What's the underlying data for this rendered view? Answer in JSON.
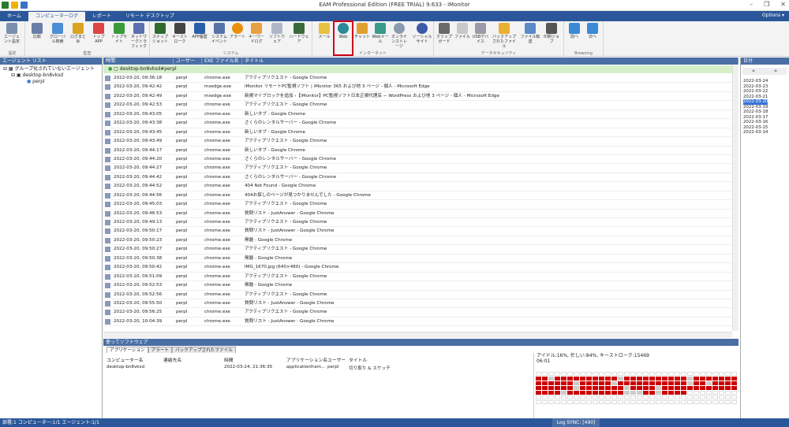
{
  "window": {
    "title": "EAM Professional Edition (FREE TRIAL) 9.633 - iMonitor"
  },
  "tabs": [
    "ホーム",
    "コンピューターログ",
    "レポート",
    "リモート デスクトップ"
  ],
  "options_label": "Options",
  "ribbon": {
    "groups": {
      "settings": "設定",
      "audit": "監査",
      "system": "システム",
      "internet": "インターネット",
      "data_security": "データセキュリティ",
      "browsing": "Browsing"
    },
    "buttons": {
      "agent_settings": "エージェント設定",
      "compare": "比較",
      "global_search": "グローバル検索",
      "log_summary": "ログまとめ",
      "top_app": "トップAPP",
      "top_site": "トップサイト",
      "network_traffic": "ネットワークトラフィック",
      "snapshot": "スナップショット",
      "keystrokes": "キーストローク",
      "app_history": "APP履歴",
      "system_events": "システムイベント",
      "alerts": "アラート",
      "keyword_log": "キーワードログ",
      "software": "ソフトウェア",
      "hardware": "ハードウェア",
      "mail": "メール",
      "web": "Web",
      "chat": "チャット",
      "web_mail": "Webメール",
      "online_storage": "オンラインストレージ",
      "social_site": "ソーシャルサイト",
      "clipboard": "クリップボード",
      "file": "ファイル",
      "usb_device": "USBデバイス",
      "backup_files": "バックアップされたファイル",
      "file_transfer": "ファイル転送",
      "print_job": "印刷ジョブ",
      "prev": "前へ",
      "next": "次へ"
    }
  },
  "agent_list": {
    "title": "エージェント リスト",
    "ungrouped": "グループ化されていないエージェント",
    "computer": "desktop-bn8vksd",
    "user": "perpl"
  },
  "grid": {
    "columns": [
      "時間",
      "ユーザー",
      "EXE ファイル名",
      "タイトル"
    ],
    "group_label": "desktop-bn8vksd#perpl",
    "rows": [
      [
        "2022-03-20, 09:36:18",
        "perpl",
        "chrome.exe",
        "アクティブリクエスト - Google Chrome"
      ],
      [
        "2022-03-20, 09:42:42",
        "perpl",
        "msedge.exe",
        "iMonitor リモートPC監視ソフト | iMonitor 365 および他 3 ページ - 個人 - Microsoft Edge"
      ],
      [
        "2022-03-20, 09:42:49",
        "perpl",
        "msedge.exe",
        "新規マイブロックを追加 ‹【iMonitor】PC監視ソフト日本正規代理店 − WordPress および他 3 ページ - 個人 - Microsoft Edge"
      ],
      [
        "2022-03-20, 09:42:53",
        "perpl",
        "chrome.exe",
        "アクティブリクエスト - Google Chrome"
      ],
      [
        "2022-03-20, 09:43:05",
        "perpl",
        "chrome.exe",
        "新しいタブ - Google Chrome"
      ],
      [
        "2022-03-20, 09:43:38",
        "perpl",
        "chrome.exe",
        "さくらのレンタルサーバー - Google Chrome"
      ],
      [
        "2022-03-20, 09:43:45",
        "perpl",
        "chrome.exe",
        "新しいタブ - Google Chrome"
      ],
      [
        "2022-03-20, 09:43:49",
        "perpl",
        "chrome.exe",
        "アクティブリクエスト - Google Chrome"
      ],
      [
        "2022-03-20, 09:44:17",
        "perpl",
        "chrome.exe",
        "新しいタブ - Google Chrome"
      ],
      [
        "2022-03-20, 09:44:20",
        "perpl",
        "chrome.exe",
        "さくらのレンタルサーバー - Google Chrome"
      ],
      [
        "2022-03-20, 09:44:27",
        "perpl",
        "chrome.exe",
        "アクティブリクエスト - Google Chrome"
      ],
      [
        "2022-03-20, 09:44:42",
        "perpl",
        "chrome.exe",
        "さくらのレンタルサーバー - Google Chrome"
      ],
      [
        "2022-03-20, 09:44:52",
        "perpl",
        "chrome.exe",
        "404 Not Found - Google Chrome"
      ],
      [
        "2022-03-20, 09:44:56",
        "perpl",
        "chrome.exe",
        "404お探しのページが見つかりませんでした - Google Chrome"
      ],
      [
        "2022-03-20, 09:45:03",
        "perpl",
        "chrome.exe",
        "アクティブリクエスト - Google Chrome"
      ],
      [
        "2022-03-20, 09:48:53",
        "perpl",
        "chrome.exe",
        "質問リスト - JustAnswer - Google Chrome"
      ],
      [
        "2022-03-20, 09:49:13",
        "perpl",
        "chrome.exe",
        "アクティブリクエスト - Google Chrome"
      ],
      [
        "2022-03-20, 09:50:17",
        "perpl",
        "chrome.exe",
        "質問リスト - JustAnswer - Google Chrome"
      ],
      [
        "2022-03-20, 09:50:23",
        "perpl",
        "chrome.exe",
        "無題 - Google Chrome"
      ],
      [
        "2022-03-20, 09:50:27",
        "perpl",
        "chrome.exe",
        "アクティブリクエスト - Google Chrome"
      ],
      [
        "2022-03-20, 09:50:38",
        "perpl",
        "chrome.exe",
        "無題 - Google Chrome"
      ],
      [
        "2022-03-20, 09:50:42",
        "perpl",
        "chrome.exe",
        "IMG_1670.jpg (640×480) - Google Chrome"
      ],
      [
        "2022-03-20, 09:51:09",
        "perpl",
        "chrome.exe",
        "アクティブリクエスト - Google Chrome"
      ],
      [
        "2022-03-20, 09:52:53",
        "perpl",
        "chrome.exe",
        "無題 - Google Chrome"
      ],
      [
        "2022-03-20, 09:52:56",
        "perpl",
        "chrome.exe",
        "アクティブリクエスト - Google Chrome"
      ],
      [
        "2022-03-20, 09:55:50",
        "perpl",
        "chrome.exe",
        "質問リスト - JustAnswer - Google Chrome"
      ],
      [
        "2022-03-20, 09:56:25",
        "perpl",
        "chrome.exe",
        "アクティブリクエスト - Google Chrome"
      ],
      [
        "2022-03-20, 10:04:39",
        "perpl",
        "chrome.exe",
        "質問リスト - JustAnswer - Google Chrome"
      ]
    ]
  },
  "dates": {
    "title": "日付",
    "list": [
      "2022-03-24",
      "2022-03-23",
      "2022-03-22",
      "2022-03-21",
      "2022-03-20",
      "2022-03-19",
      "2022-03-18",
      "2022-03-17",
      "2022-03-16",
      "2022-03-15",
      "2022-03-14"
    ],
    "selected": "2022-03-20"
  },
  "bottom": {
    "title": "使ってソフトウェア",
    "tabs": [
      "アプリケーション",
      "アラート",
      "バックアップされたファイル"
    ],
    "columns": [
      "コンピューター名",
      "連絡先名",
      "時間",
      "アプリケーション名",
      "ユーザー",
      "タイトル"
    ],
    "row": [
      "desktop-bn8vksd",
      "",
      "2022-03-24, 21:36:35",
      "applicationfram...",
      "perpl",
      "切り取り & スケッチ"
    ],
    "idle_text": "アイドル:16%, 忙しい:84%, キーストローク:15469",
    "idle_time": "06:01"
  },
  "status": {
    "left": "部署:1 コンピューター:1/1 エージェント:1/1",
    "sync": "Log SYNC: [490]"
  },
  "colors": {
    "accent": "#2b579a",
    "highlight": "#d0021b",
    "activity": "#cc0000"
  }
}
